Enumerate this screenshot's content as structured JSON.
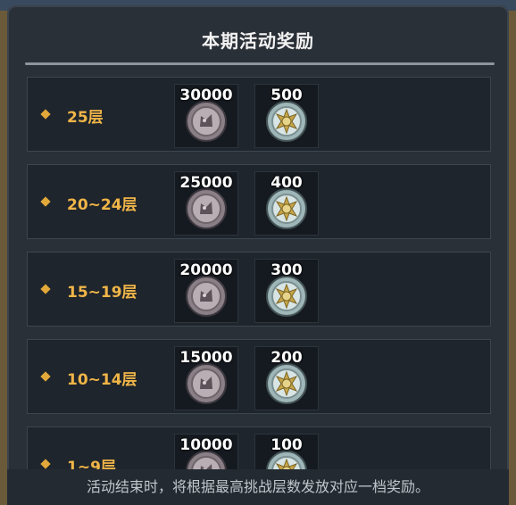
{
  "panel": {
    "title": "本期活动奖励",
    "footer_note": "活动结束时，将根据最高挑战层数发放对应一档奖励。"
  },
  "rewards": [
    {
      "tier": "25层",
      "silver": "30000",
      "sun": "500"
    },
    {
      "tier": "20~24层",
      "silver": "25000",
      "sun": "400"
    },
    {
      "tier": "15~19层",
      "silver": "20000",
      "sun": "300"
    },
    {
      "tier": "10~14层",
      "silver": "15000",
      "sun": "200"
    },
    {
      "tier": "1~9层",
      "silver": "10000",
      "sun": "100"
    }
  ],
  "icons": {
    "silver_coin": "silver-coin-icon",
    "sun_coin": "sun-coin-icon"
  },
  "colors": {
    "accent": "#f0b548",
    "panel_bg": "#2a3038"
  }
}
